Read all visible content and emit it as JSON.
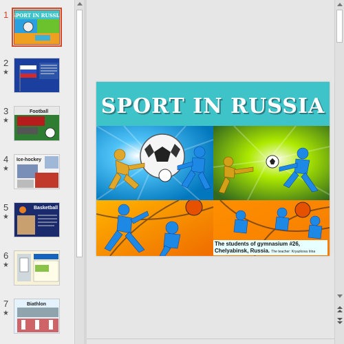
{
  "thumbnails": [
    {
      "number": "1",
      "star": "",
      "caption": "SPORT IN RUSSIA"
    },
    {
      "number": "2",
      "star": "★",
      "caption": ""
    },
    {
      "number": "3",
      "star": "★",
      "caption": "Football"
    },
    {
      "number": "4",
      "star": "★",
      "caption": "Ice-hockey"
    },
    {
      "number": "5",
      "star": "★",
      "caption": "Basketball"
    },
    {
      "number": "6",
      "star": "★",
      "caption": ""
    },
    {
      "number": "7",
      "star": "★",
      "caption": "Biathlon"
    }
  ],
  "slide": {
    "title": "SPORT IN RUSSIA",
    "caption_line1": "The students of gymnasium #26,",
    "caption_line2": "Chelyabinsk, Russia.",
    "caption_teacher": "The teacher: Kryazkova Irina"
  },
  "colors": {
    "title_band": "#3ec3c9",
    "active_accent": "#d24726",
    "caption_bg": "#e8ffff"
  },
  "icons": {
    "scroll_up": "triangle-up",
    "scroll_down": "triangle-down",
    "prev_slide": "double-chevron-up",
    "next_slide": "double-chevron-down"
  }
}
